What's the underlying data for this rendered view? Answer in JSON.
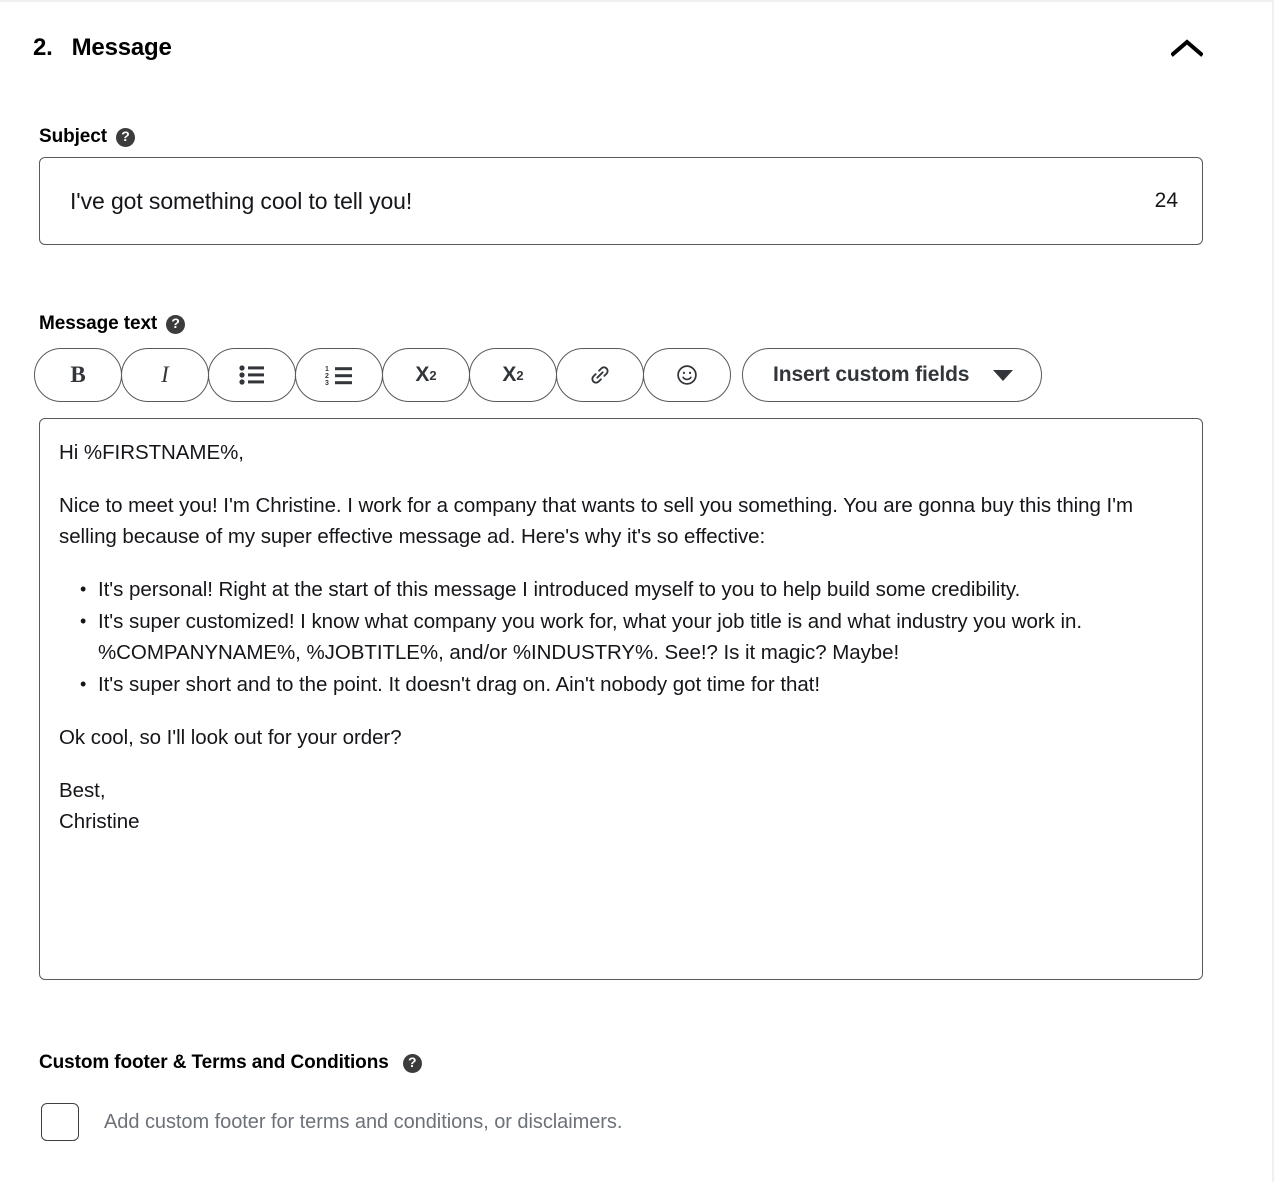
{
  "section": {
    "number": "2.",
    "title": "Message",
    "collapse_icon": "chevron-up-icon",
    "collapsed": false
  },
  "subject": {
    "label": "Subject",
    "help_icon": "help-circle-icon",
    "value": "I've got something cool to tell you!",
    "placeholder": "Subject",
    "char_count": "24"
  },
  "message_text": {
    "label": "Message text",
    "help_icon": "help-circle-icon",
    "toolbar": [
      {
        "name": "bold-button",
        "glyph": "B",
        "icon": "bold-icon"
      },
      {
        "name": "italic-button",
        "glyph": "I",
        "icon": "italic-icon"
      },
      {
        "name": "bulleted-list-button",
        "glyph": "",
        "icon": "bulleted-list-icon"
      },
      {
        "name": "numbered-list-button",
        "glyph": "",
        "icon": "numbered-list-icon"
      },
      {
        "name": "superscript-button",
        "glyph": "X2",
        "icon": "superscript-icon"
      },
      {
        "name": "subscript-button",
        "glyph": "X2",
        "icon": "subscript-icon"
      },
      {
        "name": "link-button",
        "glyph": "",
        "icon": "link-icon"
      },
      {
        "name": "emoji-button",
        "glyph": "",
        "icon": "emoji-smiley-icon"
      }
    ],
    "insert_custom_fields": {
      "label": "Insert custom fields",
      "caret_icon": "chevron-down-icon"
    },
    "body": {
      "greeting": "Hi %FIRSTNAME%,",
      "intro": "Nice to meet you! I'm Christine. I work for a company that wants to sell you something. You are gonna buy this thing I'm selling because of my super effective message ad. Here's why it's so effective:",
      "bullets": [
        "It's personal! Right at the start of this message I introduced myself to you to help build some credibility.",
        "It's super customized! I know what company you work for, what your job title is and what industry you work in. %COMPANYNAME%, %JOBTITLE%, and/or %INDUSTRY%. See!? Is it magic? Maybe!",
        "It's super short and to the point. It doesn't drag on. Ain't nobody got time for that!"
      ],
      "closing": "Ok cool, so I'll look out for your order?",
      "signoff": "Best,",
      "signature": "Christine"
    }
  },
  "custom_footer": {
    "label": "Custom footer & Terms and Conditions",
    "help_icon": "help-circle-icon",
    "checkbox_checked": false,
    "checkbox_label": "Add custom footer for terms and conditions, or disclaimers."
  },
  "colors": {
    "border": "#555a5f",
    "text": "#14161a",
    "muted_text": "#6d7278",
    "page_border": "#eef0f2",
    "help_icon_bg": "#3c3c3c"
  }
}
